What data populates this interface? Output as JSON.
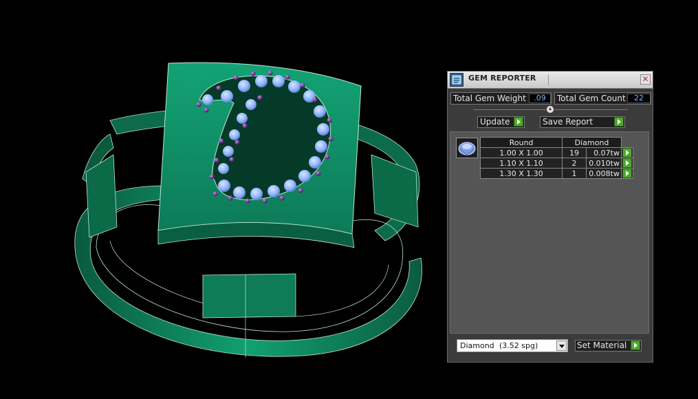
{
  "window": {
    "title": "GEM REPORTER",
    "close": "✕"
  },
  "stats": {
    "total_weight_label": "Total Gem Weight",
    "total_weight_value": ".09",
    "total_count_label": "Total Gem Count",
    "total_count_value": "22"
  },
  "buttons": {
    "update": "Update",
    "save_report": "Save Report",
    "set_material": "Set Material"
  },
  "table": {
    "shape_header": "Round",
    "material_header": "Diamond",
    "rows": [
      {
        "size": "1.00 X 1.00",
        "count": "19",
        "weight": "0.07tw"
      },
      {
        "size": "1.10 X 1.10",
        "count": "2",
        "weight": "0.010tw"
      },
      {
        "size": "1.30 X 1.30",
        "count": "1",
        "weight": "0.008tw"
      }
    ]
  },
  "material_select": {
    "name": "Diamond",
    "spg": "(3.52 spg)"
  },
  "colors": {
    "ring": "#0f7a55",
    "gem": "#8fb4ff",
    "bead": "#6a2a8c",
    "go_button": "#4caa2c"
  }
}
